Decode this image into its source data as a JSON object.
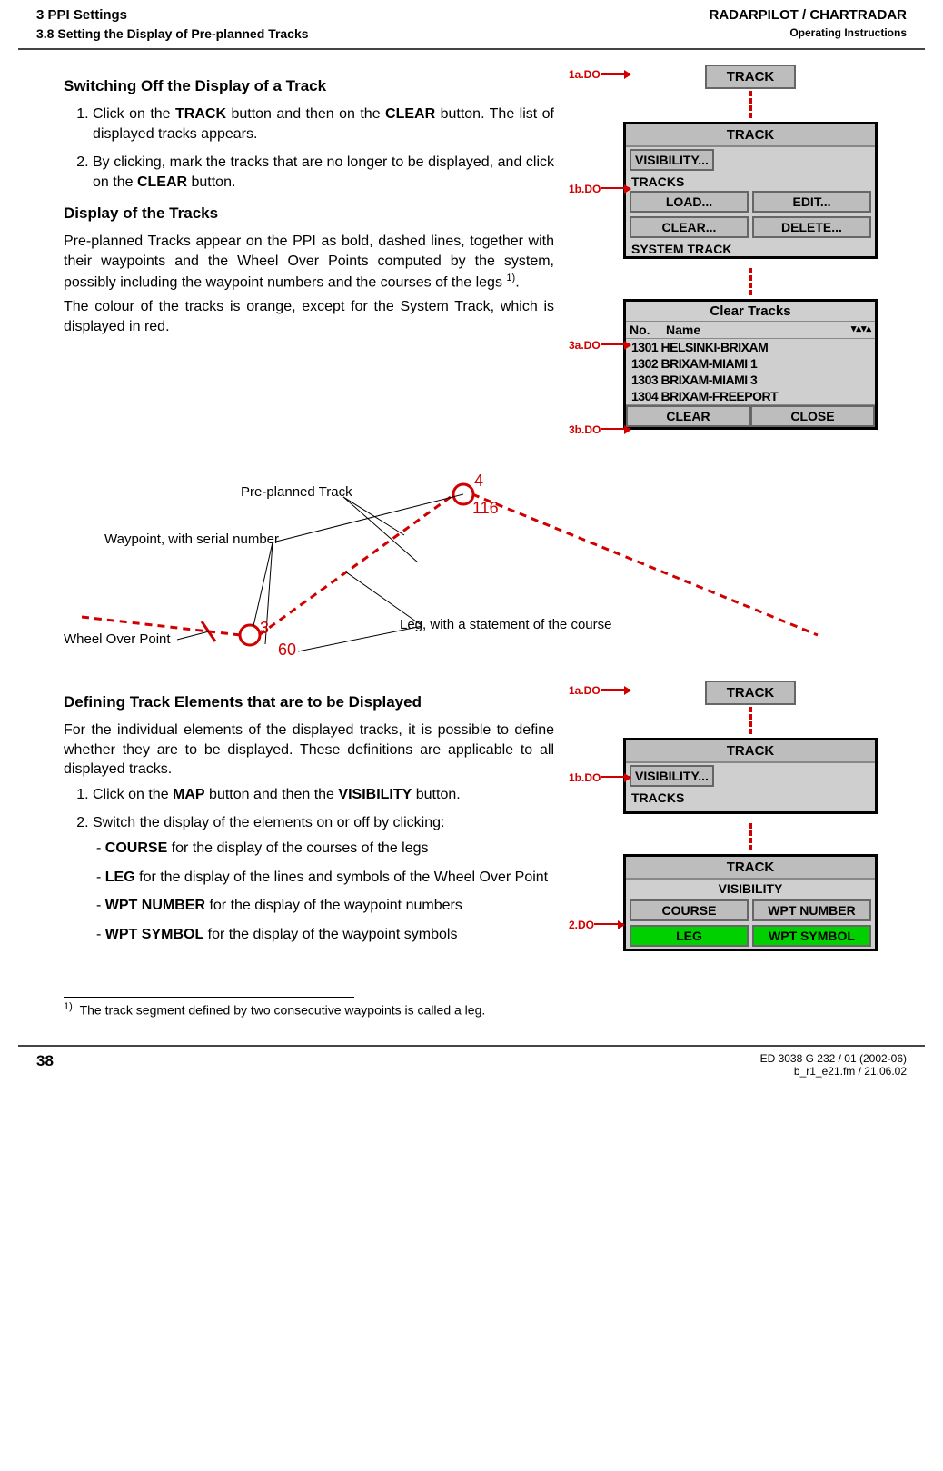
{
  "header": {
    "chapter": "3   PPI Settings",
    "section": "3.8   Setting the Display of Pre-planned Tracks",
    "product": "RADARPILOT / CHARTRADAR",
    "doctype": "Operating Instructions"
  },
  "sec1": {
    "title": "Switching Off the Display of a Track",
    "step1a": "Click on the ",
    "step1b": " button and then on the ",
    "step1c": " button. The list of displayed tracks appears.",
    "bold1": "TRACK",
    "bold2": "CLEAR",
    "step2a": "By clicking, mark the tracks that are no longer to be displayed, and click on the ",
    "step2b": " button.",
    "bold3": "CLEAR"
  },
  "sec2": {
    "title": "Display of the Tracks",
    "p1a": "Pre-planned Tracks appear on the PPI as bold, dashed lines, together with their waypoints and the Wheel Over Points computed by the system, possibly including the waypoint numbers and the courses of the legs ",
    "p1sup": "1)",
    "p1b": ".",
    "p2": "The colour of the tracks is orange, except for the System Track, which is displayed in red."
  },
  "ui1": {
    "tag1a": "1a.DO",
    "tag1b": "1b.DO",
    "tag3a": "3a.DO",
    "tag3b": "3b.DO",
    "trackBtn": "TRACK",
    "panelTitle": "TRACK",
    "visibility": "VISIBILITY...",
    "tracksLabel": "TRACKS",
    "load": "LOAD...",
    "edit": "EDIT...",
    "clear": "CLEAR...",
    "delete": "DELETE...",
    "systemTrack": "SYSTEM TRACK",
    "clearTracksTitle": "Clear Tracks",
    "colNo": "No.",
    "colName": "Name",
    "rows": [
      "1301 HELSINKI-BRIXAM",
      "1302 BRIXAM-MIAMI 1",
      "1303 BRIXAM-MIAMI 3",
      "1304 BRIXAM-FREEPORT"
    ],
    "clearBtn": "CLEAR",
    "closeBtn": "CLOSE"
  },
  "diagram": {
    "annoPreplanned": "Pre-planned Track",
    "annoWaypoint": "Waypoint, with serial number",
    "annoWheel": "Wheel Over Point",
    "annoLeg": "Leg, with a statement of the course",
    "wp3": "3",
    "wp4": "4",
    "course60": "60",
    "course116": "116"
  },
  "sec3": {
    "title": "Defining Track Elements that are to be Displayed",
    "p1": "For the individual elements of the displayed tracks, it is possible to define whether they are to be displayed. These definitions are applicable to all displayed tracks.",
    "step1a": "Click on the ",
    "step1bold1": "MAP",
    "step1b": " button and then the ",
    "step1bold2": "VISIBILITY",
    "step1c": " button.",
    "step2": "Switch the display of the elements on or off by clicking:",
    "li1bold": "COURSE",
    "li1": " for the display of the courses of the legs",
    "li2bold": "LEG",
    "li2": " for the display of the lines and symbols of the Wheel Over Point",
    "li3bold": "WPT NUMBER",
    "li3": " for the display of the waypoint numbers",
    "li4bold": "WPT SYMBOL",
    "li4": " for the display of the waypoint symbols"
  },
  "ui2": {
    "tag1a": "1a.DO",
    "tag1b": "1b.DO",
    "tag2": "2.DO",
    "trackBtn": "TRACK",
    "panelTitle": "TRACK",
    "visibility": "VISIBILITY...",
    "tracksLabel": "TRACKS",
    "visPanelTitle": "TRACK",
    "visLabel": "VISIBILITY",
    "course": "COURSE",
    "wptNumber": "WPT NUMBER",
    "leg": "LEG",
    "wptSymbol": "WPT SYMBOL"
  },
  "footnote": {
    "mark": "1)",
    "text": "The track segment defined by two consecutive waypoints is called a leg."
  },
  "footer": {
    "page": "38",
    "doc": "ED 3038 G 232 / 01 (2002-06)",
    "file": "b_r1_e21.fm / 21.06.02"
  }
}
